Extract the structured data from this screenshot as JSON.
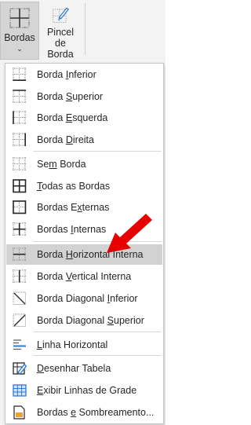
{
  "ribbon": {
    "bordas": {
      "label": "Bordas",
      "icon": "borders-icon"
    },
    "pincel": {
      "label_line1": "Pincel",
      "label_line2": "de Borda",
      "icon": "border-painter-icon"
    }
  },
  "menu": {
    "items": [
      {
        "pre": "Borda ",
        "ak": "I",
        "post": "nferior",
        "icon": "border-bottom-icon"
      },
      {
        "pre": "Borda ",
        "ak": "S",
        "post": "uperior",
        "icon": "border-top-icon"
      },
      {
        "pre": "Borda ",
        "ak": "E",
        "post": "squerda",
        "icon": "border-left-icon"
      },
      {
        "pre": "Borda ",
        "ak": "D",
        "post": "ireita",
        "icon": "border-right-icon"
      },
      {
        "pre": "Se",
        "ak": "m",
        "post": " Borda",
        "icon": "no-border-icon"
      },
      {
        "pre": "",
        "ak": "T",
        "post": "odas as Bordas",
        "icon": "all-borders-icon"
      },
      {
        "pre": "Bordas E",
        "ak": "x",
        "post": "ternas",
        "icon": "outside-borders-icon"
      },
      {
        "pre": "Bordas ",
        "ak": "I",
        "post": "nternas",
        "icon": "inside-borders-icon"
      },
      {
        "pre": "Borda ",
        "ak": "H",
        "post": "orizontal Interna",
        "icon": "inside-horizontal-border-icon",
        "highlight": true
      },
      {
        "pre": "Borda ",
        "ak": "V",
        "post": "ertical Interna",
        "icon": "inside-vertical-border-icon"
      },
      {
        "pre": "Borda Diagonal ",
        "ak": "I",
        "post": "nferior",
        "icon": "diagonal-down-border-icon"
      },
      {
        "pre": "Borda Diagonal ",
        "ak": "S",
        "post": "uperior",
        "icon": "diagonal-up-border-icon"
      },
      {
        "pre": "",
        "ak": "L",
        "post": "inha Horizontal",
        "icon": "horizontal-line-icon"
      },
      {
        "pre": "",
        "ak": "D",
        "post": "esenhar Tabela",
        "icon": "draw-table-icon"
      },
      {
        "pre": "",
        "ak": "E",
        "post": "xibir Linhas de Grade",
        "icon": "view-gridlines-icon"
      },
      {
        "pre": "Bordas ",
        "ak": "e",
        "post": " Sombreamento...",
        "icon": "borders-shading-icon"
      }
    ]
  },
  "colors": {
    "highlight": "#d2d2d2",
    "arrow": "#e60000",
    "icon_blue": "#2b7bd4"
  }
}
